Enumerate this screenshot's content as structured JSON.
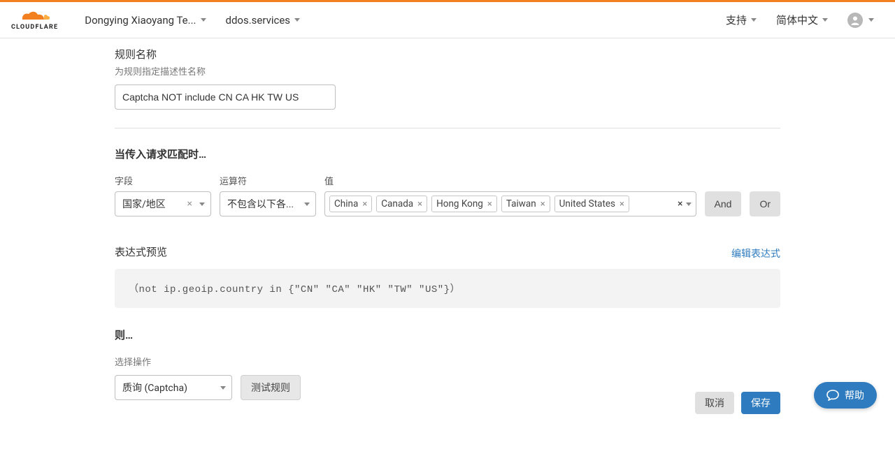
{
  "header": {
    "logo_text": "CLOUDFLARE",
    "account": "Dongying Xiaoyang Te...",
    "domain": "ddos.services",
    "support": "支持",
    "language": "简体中文"
  },
  "rule_name": {
    "label": "规则名称",
    "sub": "为规则指定描述性名称",
    "value": "Captcha NOT include CN CA HK TW US"
  },
  "match": {
    "title": "当传入请求匹配时…",
    "field_label": "字段",
    "operator_label": "运算符",
    "value_label": "值",
    "field_value": "国家/地区",
    "operator_value": "不包含以下各...",
    "tags": [
      "China",
      "Canada",
      "Hong Kong",
      "Taiwan",
      "United States"
    ],
    "and_label": "And",
    "or_label": "Or"
  },
  "preview": {
    "label": "表达式预览",
    "edit_link": "编辑表达式",
    "code": "（not ip.geoip.country in {\"CN\" \"CA\" \"HK\" \"TW\" \"US\"}）"
  },
  "action": {
    "title": "则…",
    "sub": "选择操作",
    "value": "质询 (Captcha)",
    "test_label": "测试规则"
  },
  "footer": {
    "cancel": "取消",
    "save": "保存"
  },
  "help": {
    "label": "帮助"
  }
}
